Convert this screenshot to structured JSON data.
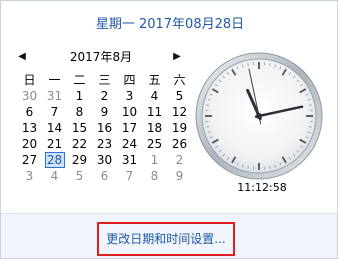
{
  "header": {
    "date_text": "星期一 2017年08月28日"
  },
  "calendar": {
    "prev_label": "◀",
    "next_label": "▶",
    "month_title": "2017年8月",
    "weekdays": [
      "日",
      "一",
      "二",
      "三",
      "四",
      "五",
      "六"
    ],
    "weeks": [
      [
        {
          "d": "30",
          "m": true
        },
        {
          "d": "31",
          "m": true
        },
        {
          "d": "1"
        },
        {
          "d": "2"
        },
        {
          "d": "3"
        },
        {
          "d": "4"
        },
        {
          "d": "5"
        }
      ],
      [
        {
          "d": "6"
        },
        {
          "d": "7"
        },
        {
          "d": "8"
        },
        {
          "d": "9"
        },
        {
          "d": "10"
        },
        {
          "d": "11"
        },
        {
          "d": "12"
        }
      ],
      [
        {
          "d": "13"
        },
        {
          "d": "14"
        },
        {
          "d": "15"
        },
        {
          "d": "16"
        },
        {
          "d": "17"
        },
        {
          "d": "18"
        },
        {
          "d": "19"
        }
      ],
      [
        {
          "d": "20"
        },
        {
          "d": "21"
        },
        {
          "d": "22"
        },
        {
          "d": "23"
        },
        {
          "d": "24"
        },
        {
          "d": "25"
        },
        {
          "d": "26"
        }
      ],
      [
        {
          "d": "27"
        },
        {
          "d": "28",
          "today": true
        },
        {
          "d": "29"
        },
        {
          "d": "30"
        },
        {
          "d": "31"
        },
        {
          "d": "1",
          "m": true
        },
        {
          "d": "2",
          "m": true
        }
      ],
      [
        {
          "d": "3",
          "m": true
        },
        {
          "d": "4",
          "m": true
        },
        {
          "d": "5",
          "m": true
        },
        {
          "d": "6",
          "m": true
        },
        {
          "d": "7",
          "m": true
        },
        {
          "d": "8",
          "m": true
        },
        {
          "d": "9",
          "m": true
        }
      ]
    ]
  },
  "clock": {
    "hours": 11,
    "minutes": 12,
    "seconds": 58,
    "time_text": "11:12:58"
  },
  "footer": {
    "link_label": "更改日期和时间设置..."
  },
  "colors": {
    "accent_text": "#1e5aa8",
    "muted_day": "#8c8c8c",
    "today_fill": "#cfe3f7",
    "highlight_border": "#e02020"
  }
}
